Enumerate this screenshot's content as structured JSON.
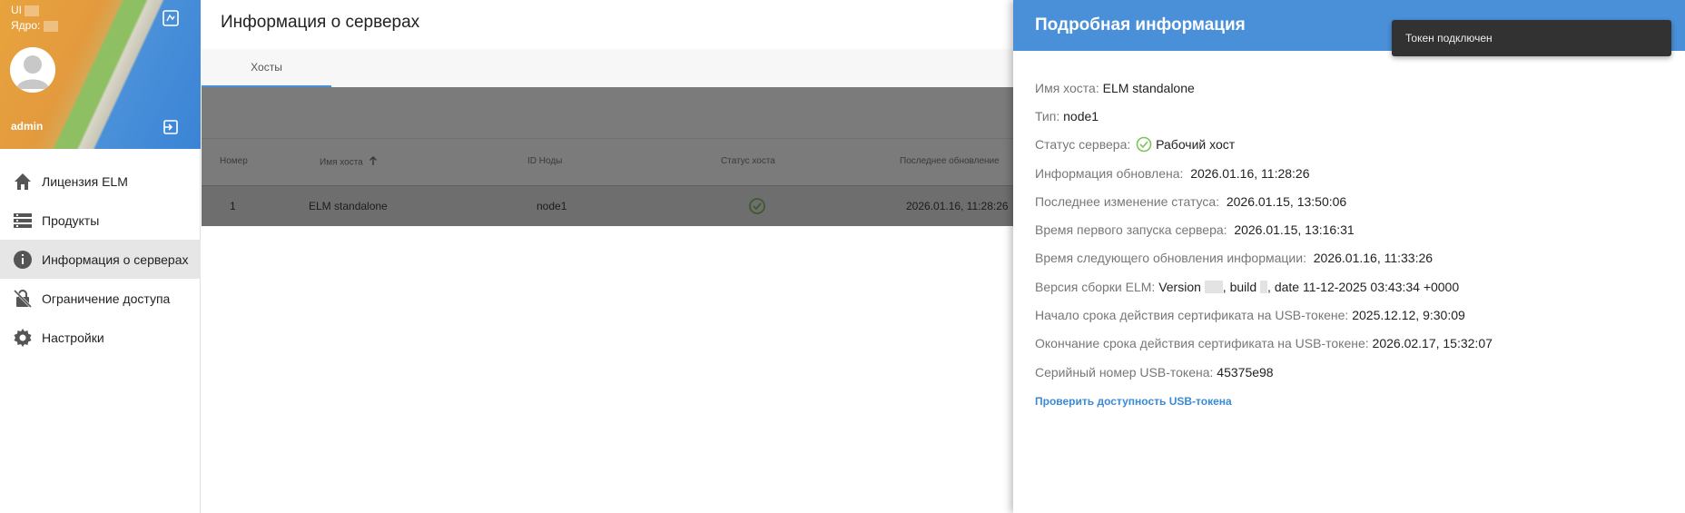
{
  "sidebar": {
    "ui_label": "UI",
    "core_label": "Ядро:",
    "username": "admin",
    "items": [
      {
        "label": "Лицензия ELM",
        "icon": "home-icon"
      },
      {
        "label": "Продукты",
        "icon": "list-icon"
      },
      {
        "label": "Информация о серверах",
        "icon": "info-icon",
        "active": true
      },
      {
        "label": "Ограничение доступа",
        "icon": "lock-icon"
      },
      {
        "label": "Настройки",
        "icon": "gear-icon"
      }
    ]
  },
  "main": {
    "title": "Информация о серверах",
    "tabs": [
      {
        "label": "Хосты"
      }
    ],
    "table": {
      "columns": [
        "Номер",
        "Имя хоста",
        "ID Ноды",
        "Статус хоста",
        "Последнее обновление"
      ],
      "rows": [
        {
          "number": "1",
          "hostname": "ELM standalone",
          "node_id": "node1",
          "status": "ok",
          "updated": "2026.01.16, 11:28:26"
        }
      ]
    }
  },
  "details": {
    "title": "Подробная информация",
    "hostname_label": "Имя хоста:",
    "hostname": "ELM standalone",
    "type_label": "Тип:",
    "type": "node1",
    "status_label": "Статус сервера:",
    "status": "Рабочий хост",
    "updated_label": "Информация обновлена:",
    "updated": "2026.01.16, 11:28:26",
    "last_change_label": "Последнее изменение статуса:",
    "last_change": "2026.01.15, 13:50:06",
    "first_start_label": "Время первого запуска сервера:",
    "first_start": "2026.01.15, 13:16:31",
    "next_update_label": "Время следующего обновления информации:",
    "next_update": "2026.01.16, 11:33:26",
    "build_label": "Версия сборки ELM:",
    "build_version_prefix": "Version",
    "build_mid": ", build",
    "build_suffix": ", date 11-12-2025 03:43:34 +0000",
    "cert_start_label": "Начало срока действия сертификата на USB-токене:",
    "cert_start": "2025.12.12, 9:30:09",
    "cert_end_label": "Окончание срока действия сертификата на USB-токене:",
    "cert_end": "2026.02.17, 15:32:07",
    "serial_label": "Серийный номер USB-токена:",
    "serial": "45375e98",
    "check_link": "Проверить доступность USB-токена"
  },
  "toast": {
    "message": "Токен подключен"
  },
  "colors": {
    "accent": "#4a90d9",
    "status_ok": "#7cc35a",
    "link": "#3a8ad6"
  }
}
